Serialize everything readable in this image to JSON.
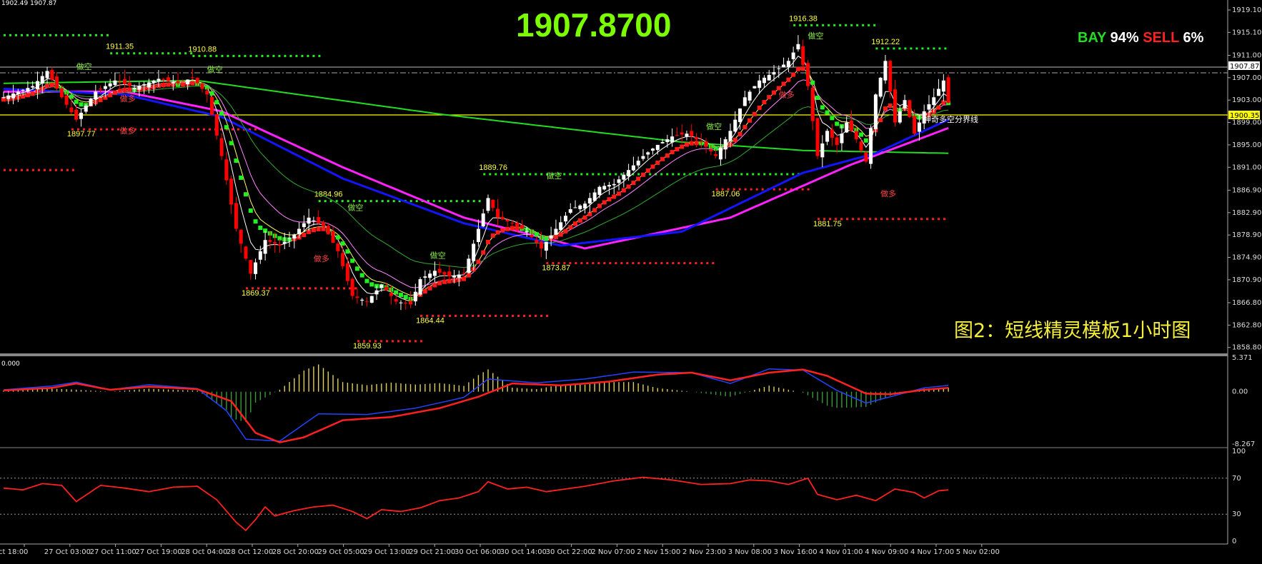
{
  "header": {
    "ohlc_text": "1902.49 1907.87",
    "current_price_big": "1907.8700",
    "bay_label": "BAY",
    "bay_pct": "94%",
    "sell_label": "SELL",
    "sell_pct": "6%"
  },
  "caption": "图2：短线精灵模板1小时图",
  "colors": {
    "background": "#000000",
    "bull_candle": "#ffffff",
    "bear_candle": "#ff0000",
    "ma_blue": "#1414ff",
    "ma_magenta": "#ff22ff",
    "ma_green": "#22dd22",
    "step_up": "#ff1a1a",
    "step_down": "#22ee22",
    "support_dots": "#ff2020",
    "resistance_dots": "#22ee22",
    "label_yellow": "#ffff44",
    "caption_yellow": "#f5ef3a",
    "line_yellow": "#ffff00"
  },
  "chart_data": [
    {
      "type": "candlestick",
      "panel": "price",
      "y_ticks": [
        "1919.10",
        "1915.10",
        "1911.00",
        "1907.00",
        "1903.00",
        "1899.00",
        "1895.00",
        "1891.00",
        "1886.90",
        "1882.90",
        "1878.90",
        "1874.90",
        "1870.90",
        "1866.80",
        "1862.80",
        "1858.80"
      ],
      "ylim": [
        1858.0,
        1920.5
      ],
      "x_ticks": [
        "ct 18:00",
        "27 Oct 03:00",
        "27 Oct 11:00",
        "27 Oct 19:00",
        "28 Oct 04:00",
        "28 Oct 12:00",
        "28 Oct 20:00",
        "29 Oct 05:00",
        "29 Oct 13:00",
        "29 Oct 21:00",
        "30 Oct 06:00",
        "30 Oct 14:00",
        "30 Oct 22:00",
        "2 Nov 07:00",
        "2 Nov 15:00",
        "2 Nov 23:00",
        "3 Nov 08:00",
        "3 Nov 16:00",
        "4 Nov 01:00",
        "4 Nov 09:00",
        "4 Nov 17:00",
        "5 Nov 02:00"
      ],
      "price_tags": {
        "current": "1907.87",
        "boundary": "1900.35"
      },
      "boundary_label": "神奇多空分界线",
      "price_anchors": [
        {
          "i": 0,
          "p": 1903.5
        },
        {
          "i": 6,
          "p": 1905.5
        },
        {
          "i": 9,
          "p": 1908.2
        },
        {
          "i": 12,
          "p": 1903.5
        },
        {
          "i": 15,
          "p": 1899.5
        },
        {
          "i": 19,
          "p": 1904.5
        },
        {
          "i": 23,
          "p": 1906.5
        },
        {
          "i": 27,
          "p": 1905.2
        },
        {
          "i": 32,
          "p": 1906.8
        },
        {
          "i": 36,
          "p": 1906.0
        },
        {
          "i": 39,
          "p": 1907.0
        },
        {
          "i": 42,
          "p": 1904.0
        },
        {
          "i": 45,
          "p": 1893.0
        },
        {
          "i": 48,
          "p": 1880.0
        },
        {
          "i": 51,
          "p": 1872.0
        },
        {
          "i": 54,
          "p": 1878.0
        },
        {
          "i": 57,
          "p": 1877.0
        },
        {
          "i": 60,
          "p": 1879.0
        },
        {
          "i": 63,
          "p": 1882.0
        },
        {
          "i": 66,
          "p": 1880.5
        },
        {
          "i": 69,
          "p": 1876.0
        },
        {
          "i": 72,
          "p": 1868.0
        },
        {
          "i": 75,
          "p": 1867.0
        },
        {
          "i": 78,
          "p": 1870.0
        },
        {
          "i": 81,
          "p": 1867.0
        },
        {
          "i": 84,
          "p": 1866.5
        },
        {
          "i": 86,
          "p": 1871.0
        },
        {
          "i": 89,
          "p": 1872.5
        },
        {
          "i": 92,
          "p": 1871.5
        },
        {
          "i": 95,
          "p": 1872.0
        },
        {
          "i": 98,
          "p": 1880.0
        },
        {
          "i": 100,
          "p": 1885.5
        },
        {
          "i": 102,
          "p": 1882.0
        },
        {
          "i": 105,
          "p": 1881.0
        },
        {
          "i": 108,
          "p": 1879.5
        },
        {
          "i": 111,
          "p": 1876.5
        },
        {
          "i": 114,
          "p": 1880.0
        },
        {
          "i": 117,
          "p": 1883.5
        },
        {
          "i": 120,
          "p": 1884.5
        },
        {
          "i": 123,
          "p": 1887.5
        },
        {
          "i": 126,
          "p": 1888.0
        },
        {
          "i": 129,
          "p": 1890.5
        },
        {
          "i": 132,
          "p": 1893.0
        },
        {
          "i": 135,
          "p": 1895.0
        },
        {
          "i": 138,
          "p": 1896.5
        },
        {
          "i": 141,
          "p": 1897.0
        },
        {
          "i": 144,
          "p": 1895.5
        },
        {
          "i": 147,
          "p": 1893.0
        },
        {
          "i": 150,
          "p": 1897.5
        },
        {
          "i": 153,
          "p": 1903.5
        },
        {
          "i": 156,
          "p": 1906.5
        },
        {
          "i": 159,
          "p": 1908.0
        },
        {
          "i": 162,
          "p": 1910.0
        },
        {
          "i": 164,
          "p": 1913.0
        },
        {
          "i": 166,
          "p": 1905.5
        },
        {
          "i": 168,
          "p": 1893.0
        },
        {
          "i": 170,
          "p": 1897.5
        },
        {
          "i": 172,
          "p": 1895.0
        },
        {
          "i": 174,
          "p": 1899.0
        },
        {
          "i": 176,
          "p": 1896.0
        },
        {
          "i": 178,
          "p": 1892.0
        },
        {
          "i": 180,
          "p": 1904.0
        },
        {
          "i": 182,
          "p": 1910.0
        },
        {
          "i": 184,
          "p": 1899.0
        },
        {
          "i": 186,
          "p": 1903.0
        },
        {
          "i": 188,
          "p": 1897.0
        },
        {
          "i": 190,
          "p": 1901.0
        },
        {
          "i": 192,
          "p": 1903.5
        },
        {
          "i": 194,
          "p": 1906.5
        },
        {
          "i": 195,
          "p": 1902.5
        }
      ],
      "indicators": {
        "ma_slow_green": [
          {
            "i": 0,
            "p": 1906.0
          },
          {
            "i": 40,
            "p": 1906.5
          },
          {
            "i": 90,
            "p": 1900.5
          },
          {
            "i": 140,
            "p": 1895.5
          },
          {
            "i": 165,
            "p": 1894.0
          },
          {
            "i": 195,
            "p": 1893.5
          }
        ],
        "ma_blue": [
          {
            "i": 0,
            "p": 1905.0
          },
          {
            "i": 25,
            "p": 1904.0
          },
          {
            "i": 45,
            "p": 1900.0
          },
          {
            "i": 70,
            "p": 1889.0
          },
          {
            "i": 95,
            "p": 1881.0
          },
          {
            "i": 115,
            "p": 1877.0
          },
          {
            "i": 140,
            "p": 1879.5
          },
          {
            "i": 165,
            "p": 1890.0
          },
          {
            "i": 180,
            "p": 1893.5
          },
          {
            "i": 195,
            "p": 1899.5
          }
        ],
        "ma_magenta": [
          {
            "i": 0,
            "p": 1904.5
          },
          {
            "i": 25,
            "p": 1904.5
          },
          {
            "i": 45,
            "p": 1901.0
          },
          {
            "i": 70,
            "p": 1891.0
          },
          {
            "i": 95,
            "p": 1882.0
          },
          {
            "i": 120,
            "p": 1876.5
          },
          {
            "i": 150,
            "p": 1882.0
          },
          {
            "i": 175,
            "p": 1891.5
          },
          {
            "i": 195,
            "p": 1898.0
          }
        ]
      },
      "support_levels": [
        {
          "value": 1897.77,
          "label": "1897.77",
          "x0": 14,
          "x1": 52
        },
        {
          "value": 1890.5,
          "label": "",
          "x0": 0,
          "x1": 15
        },
        {
          "value": 1869.37,
          "label": "1869.37",
          "x0": 50,
          "x1": 73
        },
        {
          "value": 1864.44,
          "label": "1864.44",
          "x0": 86,
          "x1": 113
        },
        {
          "value": 1859.93,
          "label": "1859.93",
          "x0": 73,
          "x1": 87
        },
        {
          "value": 1873.87,
          "label": "1873.87",
          "x0": 112,
          "x1": 147
        },
        {
          "value": 1887.06,
          "label": "1887.06",
          "x0": 147,
          "x1": 166
        },
        {
          "value": 1881.75,
          "label": "1881.75",
          "x0": 168,
          "x1": 195
        }
      ],
      "resistance_levels": [
        {
          "value": 1914.6,
          "label": "",
          "x0": 0,
          "x1": 22
        },
        {
          "value": 1911.35,
          "label": "1911.35",
          "x0": 22,
          "x1": 39
        },
        {
          "value": 1910.88,
          "label": "1910.88",
          "x0": 39,
          "x1": 66
        },
        {
          "value": 1884.96,
          "label": "1884.96",
          "x0": 65,
          "x1": 99
        },
        {
          "value": 1889.76,
          "label": "1889.76",
          "x0": 99,
          "x1": 165
        },
        {
          "value": 1916.38,
          "label": "1916.38",
          "x0": 163,
          "x1": 180
        },
        {
          "value": 1912.22,
          "label": "1912.22",
          "x0": 180,
          "x1": 195
        }
      ],
      "signals": [
        {
          "text": "做空",
          "i": 15,
          "p": 1908.5,
          "color": "#88ee44"
        },
        {
          "text": "做空",
          "i": 42,
          "p": 1908.0,
          "color": "#88ee44"
        },
        {
          "text": "做多",
          "i": 24,
          "p": 1902.8,
          "color": "#ff4444"
        },
        {
          "text": "做多",
          "i": 24,
          "p": 1897.0,
          "color": "#ff4444"
        },
        {
          "text": "做多",
          "i": 64,
          "p": 1874.2,
          "color": "#ff4444"
        },
        {
          "text": "做空",
          "i": 71,
          "p": 1883.3,
          "color": "#88ee44"
        },
        {
          "text": "做空",
          "i": 88,
          "p": 1874.8,
          "color": "#88ee44"
        },
        {
          "text": "做空",
          "i": 112,
          "p": 1889.0,
          "color": "#88ee44"
        },
        {
          "text": "做空",
          "i": 145,
          "p": 1897.8,
          "color": "#88ee44"
        },
        {
          "text": "做多",
          "i": 160,
          "p": 1903.5,
          "color": "#ff4444"
        },
        {
          "text": "做空",
          "i": 166,
          "p": 1914.0,
          "color": "#88ee44"
        },
        {
          "text": "做多",
          "i": 181,
          "p": 1885.8,
          "color": "#ff4444"
        }
      ]
    },
    {
      "type": "macd",
      "panel": "macd",
      "top_label": "0.000",
      "y_ticks": [
        "5.371",
        "0.00",
        "-8.267"
      ],
      "ylim": [
        -8.267,
        5.371
      ],
      "signal_line": [
        {
          "i": 0,
          "v": 0.2
        },
        {
          "i": 10,
          "v": 0.6
        },
        {
          "i": 15,
          "v": 1.3
        },
        {
          "i": 22,
          "v": 0.3
        },
        {
          "i": 30,
          "v": 0.8
        },
        {
          "i": 40,
          "v": 0.4
        },
        {
          "i": 47,
          "v": -1.5
        },
        {
          "i": 52,
          "v": -6.5
        },
        {
          "i": 57,
          "v": -8.0
        },
        {
          "i": 62,
          "v": -7.2
        },
        {
          "i": 70,
          "v": -4.5
        },
        {
          "i": 80,
          "v": -4.0
        },
        {
          "i": 90,
          "v": -2.6
        },
        {
          "i": 98,
          "v": -0.8
        },
        {
          "i": 105,
          "v": 1.3
        },
        {
          "i": 115,
          "v": 1.0
        },
        {
          "i": 125,
          "v": 1.6
        },
        {
          "i": 135,
          "v": 2.7
        },
        {
          "i": 142,
          "v": 3.0
        },
        {
          "i": 150,
          "v": 1.8
        },
        {
          "i": 158,
          "v": 3.0
        },
        {
          "i": 165,
          "v": 3.5
        },
        {
          "i": 170,
          "v": 2.5
        },
        {
          "i": 178,
          "v": -0.3
        },
        {
          "i": 183,
          "v": -0.4
        },
        {
          "i": 190,
          "v": 0.3
        },
        {
          "i": 195,
          "v": 0.6
        }
      ],
      "macd_line": [
        {
          "i": 0,
          "v": 0.3
        },
        {
          "i": 10,
          "v": 0.9
        },
        {
          "i": 15,
          "v": 1.5
        },
        {
          "i": 22,
          "v": 0.3
        },
        {
          "i": 30,
          "v": 1.1
        },
        {
          "i": 40,
          "v": 0.5
        },
        {
          "i": 46,
          "v": -3.0
        },
        {
          "i": 50,
          "v": -7.5
        },
        {
          "i": 57,
          "v": -7.8
        },
        {
          "i": 65,
          "v": -3.5
        },
        {
          "i": 75,
          "v": -3.6
        },
        {
          "i": 85,
          "v": -2.6
        },
        {
          "i": 95,
          "v": -0.9
        },
        {
          "i": 100,
          "v": 2.0
        },
        {
          "i": 110,
          "v": 1.4
        },
        {
          "i": 120,
          "v": 2.0
        },
        {
          "i": 130,
          "v": 3.1
        },
        {
          "i": 142,
          "v": 3.0
        },
        {
          "i": 150,
          "v": 1.3
        },
        {
          "i": 158,
          "v": 3.6
        },
        {
          "i": 165,
          "v": 3.4
        },
        {
          "i": 172,
          "v": 0.2
        },
        {
          "i": 178,
          "v": -1.8
        },
        {
          "i": 183,
          "v": -0.8
        },
        {
          "i": 190,
          "v": 0.6
        },
        {
          "i": 195,
          "v": 1.0
        }
      ]
    },
    {
      "type": "line",
      "panel": "rsi",
      "y_ticks": [
        "100",
        "70",
        "30",
        "0"
      ],
      "ylim": [
        0,
        100
      ],
      "levels": [
        70,
        30
      ],
      "values": [
        {
          "i": 0,
          "v": 59
        },
        {
          "i": 4,
          "v": 57
        },
        {
          "i": 8,
          "v": 64
        },
        {
          "i": 12,
          "v": 62
        },
        {
          "i": 15,
          "v": 44
        },
        {
          "i": 20,
          "v": 62
        },
        {
          "i": 25,
          "v": 59
        },
        {
          "i": 30,
          "v": 55
        },
        {
          "i": 35,
          "v": 60
        },
        {
          "i": 40,
          "v": 61
        },
        {
          "i": 44,
          "v": 46
        },
        {
          "i": 48,
          "v": 21
        },
        {
          "i": 50,
          "v": 12
        },
        {
          "i": 52,
          "v": 24
        },
        {
          "i": 54,
          "v": 38
        },
        {
          "i": 56,
          "v": 28
        },
        {
          "i": 60,
          "v": 34
        },
        {
          "i": 64,
          "v": 38
        },
        {
          "i": 68,
          "v": 40
        },
        {
          "i": 72,
          "v": 33
        },
        {
          "i": 75,
          "v": 25
        },
        {
          "i": 78,
          "v": 35
        },
        {
          "i": 82,
          "v": 33
        },
        {
          "i": 86,
          "v": 37
        },
        {
          "i": 90,
          "v": 45
        },
        {
          "i": 94,
          "v": 48
        },
        {
          "i": 98,
          "v": 55
        },
        {
          "i": 100,
          "v": 66
        },
        {
          "i": 104,
          "v": 58
        },
        {
          "i": 108,
          "v": 60
        },
        {
          "i": 112,
          "v": 55
        },
        {
          "i": 116,
          "v": 58
        },
        {
          "i": 120,
          "v": 61
        },
        {
          "i": 126,
          "v": 67
        },
        {
          "i": 132,
          "v": 71
        },
        {
          "i": 138,
          "v": 68
        },
        {
          "i": 144,
          "v": 63
        },
        {
          "i": 150,
          "v": 64
        },
        {
          "i": 154,
          "v": 68
        },
        {
          "i": 158,
          "v": 67
        },
        {
          "i": 162,
          "v": 63
        },
        {
          "i": 166,
          "v": 70
        },
        {
          "i": 168,
          "v": 52
        },
        {
          "i": 172,
          "v": 46
        },
        {
          "i": 176,
          "v": 51
        },
        {
          "i": 180,
          "v": 45
        },
        {
          "i": 184,
          "v": 58
        },
        {
          "i": 188,
          "v": 54
        },
        {
          "i": 190,
          "v": 48
        },
        {
          "i": 193,
          "v": 56
        },
        {
          "i": 195,
          "v": 57
        }
      ]
    }
  ]
}
